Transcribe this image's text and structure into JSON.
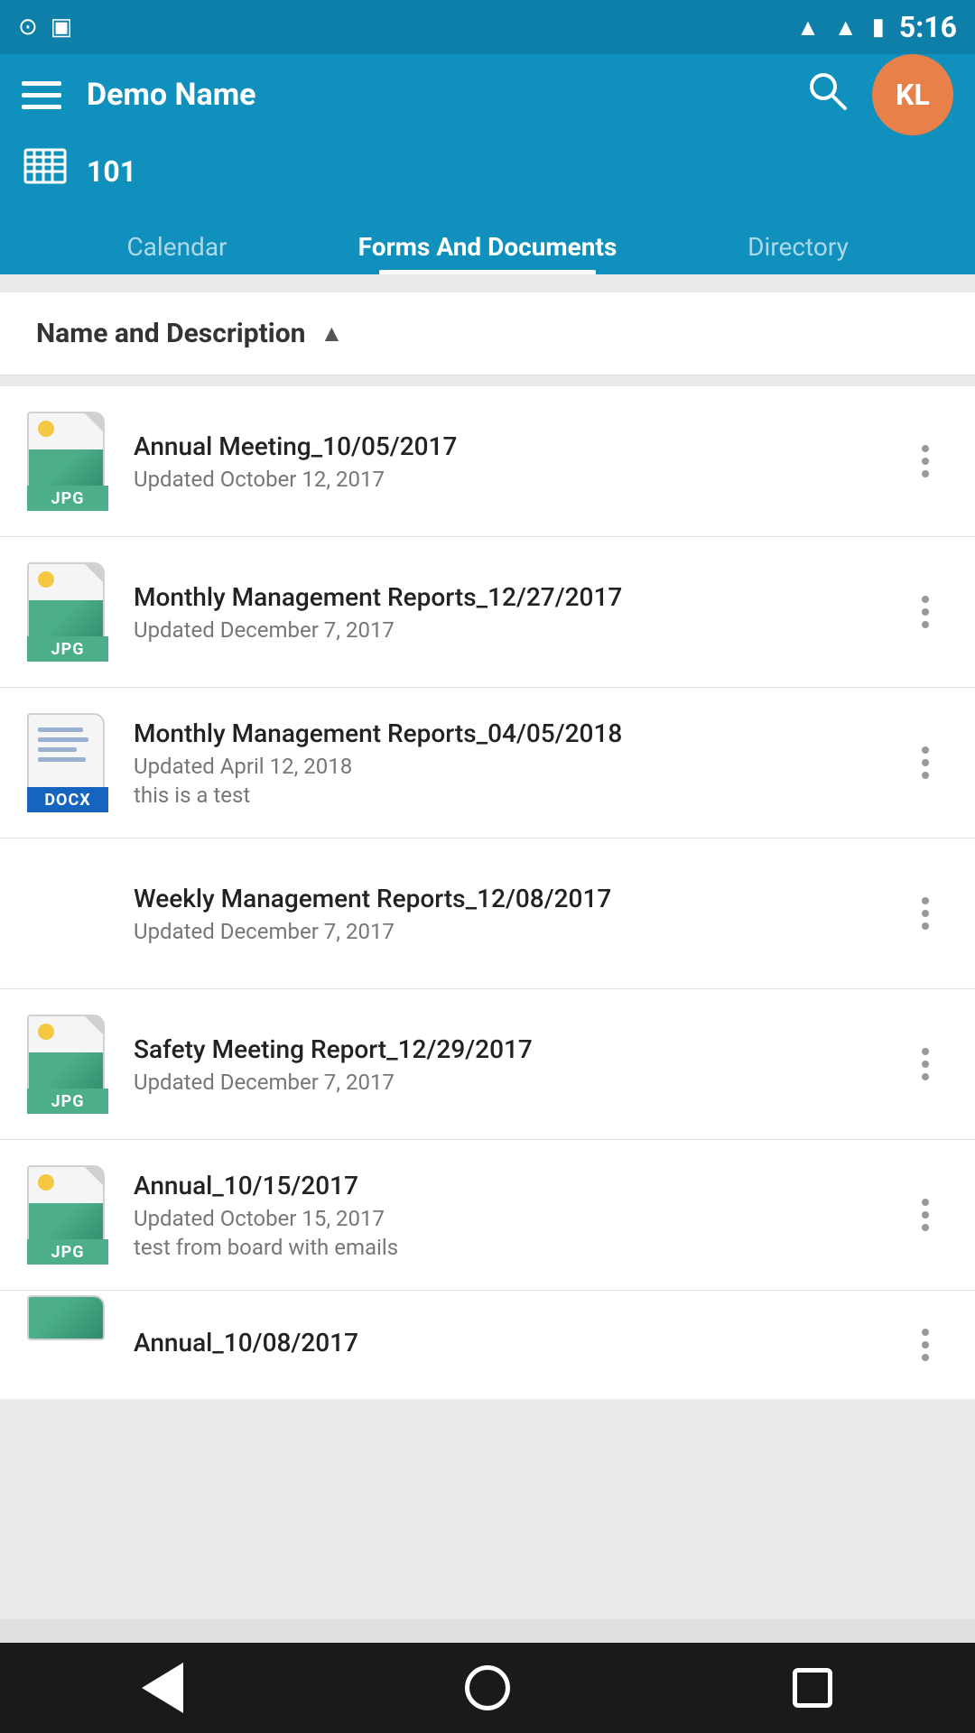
{
  "statusBar": {
    "time": "5:16",
    "icons": [
      "wifi",
      "signal",
      "battery"
    ]
  },
  "header": {
    "title": "Demo Name",
    "avatarInitials": "KL",
    "buildingNumber": "101"
  },
  "tabs": [
    {
      "id": "calendar",
      "label": "Calendar",
      "active": false
    },
    {
      "id": "forms",
      "label": "Forms And Documents",
      "active": true
    },
    {
      "id": "directory",
      "label": "Directory",
      "active": false
    }
  ],
  "sortHeader": {
    "label": "Name and Description",
    "direction": "asc"
  },
  "documents": [
    {
      "id": 1,
      "name": "Annual Meeting_10/05/2017",
      "updated": "Updated October 12, 2017",
      "description": "",
      "type": "JPG"
    },
    {
      "id": 2,
      "name": "Monthly Management Reports_12/27/2017",
      "updated": "Updated December 7, 2017",
      "description": "",
      "type": "JPG"
    },
    {
      "id": 3,
      "name": "Monthly Management Reports_04/05/2018",
      "updated": "Updated April 12, 2018",
      "description": "this is a test",
      "type": "DOCX"
    },
    {
      "id": 4,
      "name": "Weekly Management Reports_12/08/2017",
      "updated": "Updated December 7, 2017",
      "description": "",
      "type": "NONE"
    },
    {
      "id": 5,
      "name": "Safety Meeting Report_12/29/2017",
      "updated": "Updated December 7, 2017",
      "description": "",
      "type": "JPG"
    },
    {
      "id": 6,
      "name": "Annual_10/15/2017",
      "updated": "Updated October 15, 2017",
      "description": "test from board with emails",
      "type": "JPG"
    },
    {
      "id": 7,
      "name": "Annual_10/08/2017",
      "updated": "",
      "description": "",
      "type": "JPG"
    }
  ],
  "bottomNav": {
    "back": "back",
    "home": "home",
    "recent": "recent"
  }
}
